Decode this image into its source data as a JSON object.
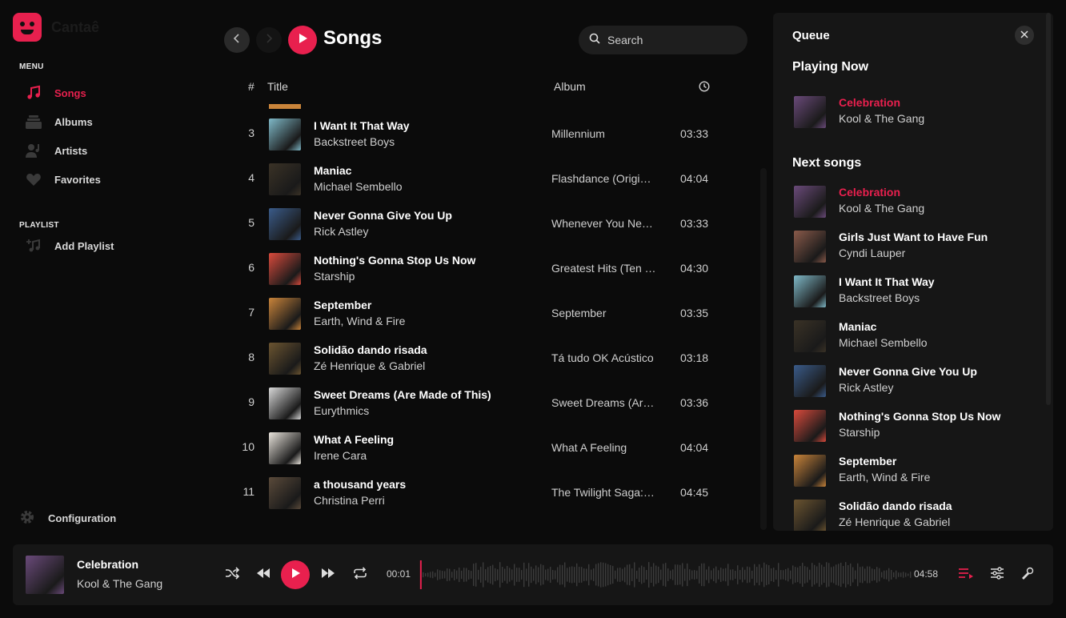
{
  "app": {
    "name": "Cantaê"
  },
  "sidebar": {
    "menu_title": "MENU",
    "items": [
      {
        "label": "Songs",
        "icon": "music-note-icon",
        "active": true
      },
      {
        "label": "Albums",
        "icon": "albums-icon",
        "active": false
      },
      {
        "label": "Artists",
        "icon": "artist-icon",
        "active": false
      },
      {
        "label": "Favorites",
        "icon": "heart-icon",
        "active": false
      }
    ],
    "playlist_title": "PLAYLIST",
    "add_playlist": "Add Playlist",
    "configuration": "Configuration"
  },
  "header": {
    "title": "Songs",
    "search_placeholder": "Search"
  },
  "table": {
    "col_num": "#",
    "col_title": "Title",
    "col_album": "Album",
    "rows": [
      {
        "num": "3",
        "title": "I Want It That Way",
        "artist": "Backstreet Boys",
        "album": "Millennium",
        "duration": "03:33",
        "art": "#7fb9c8"
      },
      {
        "num": "4",
        "title": "Maniac",
        "artist": "Michael Sembello",
        "album": "Flashdance (Original Soundtrack)",
        "duration": "04:04",
        "art": "#3a3226"
      },
      {
        "num": "5",
        "title": "Never Gonna Give You Up",
        "artist": "Rick Astley",
        "album": "Whenever You Need Somebody",
        "duration": "03:33",
        "art": "#3a5b8a"
      },
      {
        "num": "6",
        "title": "Nothing's Gonna Stop Us Now",
        "artist": "Starship",
        "album": "Greatest Hits (Ten Years and Change)",
        "duration": "04:30",
        "art": "#d94a3c"
      },
      {
        "num": "7",
        "title": "September",
        "artist": "Earth, Wind & Fire",
        "album": "September",
        "duration": "03:35",
        "art": "#c9843a"
      },
      {
        "num": "8",
        "title": "Solidão dando risada",
        "artist": "Zé Henrique & Gabriel",
        "album": "Tá tudo OK Acústico",
        "duration": "03:18",
        "art": "#6b5430"
      },
      {
        "num": "9",
        "title": "Sweet Dreams (Are Made of This)",
        "artist": "Eurythmics",
        "album": "Sweet Dreams (Are Made of This)",
        "duration": "03:36",
        "art": "#d8d8d8"
      },
      {
        "num": "10",
        "title": "What A Feeling",
        "artist": "Irene Cara",
        "album": "What A Feeling",
        "duration": "04:04",
        "art": "#e9e4dc"
      },
      {
        "num": "11",
        "title": "a thousand years",
        "artist": "Christina Perri",
        "album": "The Twilight Saga: Breaking Dawn",
        "duration": "04:45",
        "art": "#5a4a3a"
      }
    ]
  },
  "queue": {
    "title": "Queue",
    "playing_now_label": "Playing Now",
    "next_label": "Next songs",
    "playing_now": {
      "title": "Celebration",
      "artist": "Kool & The Gang",
      "art": "#6a4a7a"
    },
    "next": [
      {
        "title": "Celebration",
        "artist": "Kool & The Gang",
        "art": "#6a4a7a",
        "playing": true
      },
      {
        "title": "Girls Just Want to Have Fun",
        "artist": "Cyndi Lauper",
        "art": "#8a5a4a",
        "playing": false
      },
      {
        "title": "I Want It That Way",
        "artist": "Backstreet Boys",
        "art": "#7fb9c8",
        "playing": false
      },
      {
        "title": "Maniac",
        "artist": "Michael Sembello",
        "art": "#3a3226",
        "playing": false
      },
      {
        "title": "Never Gonna Give You Up",
        "artist": "Rick Astley",
        "art": "#3a5b8a",
        "playing": false
      },
      {
        "title": "Nothing's Gonna Stop Us Now",
        "artist": "Starship",
        "art": "#d94a3c",
        "playing": false
      },
      {
        "title": "September",
        "artist": "Earth, Wind & Fire",
        "art": "#c9843a",
        "playing": false
      },
      {
        "title": "Solidão dando risada",
        "artist": "Zé Henrique & Gabriel",
        "art": "#6b5430",
        "playing": false
      }
    ]
  },
  "player": {
    "title": "Celebration",
    "artist": "Kool & The Gang",
    "current_time": "00:01",
    "total_time": "04:58",
    "progress_fraction": 0.003,
    "art": "#6a4a7a"
  },
  "colors": {
    "accent": "#e8204e",
    "background": "#0b0b0b",
    "panel": "#161616"
  }
}
